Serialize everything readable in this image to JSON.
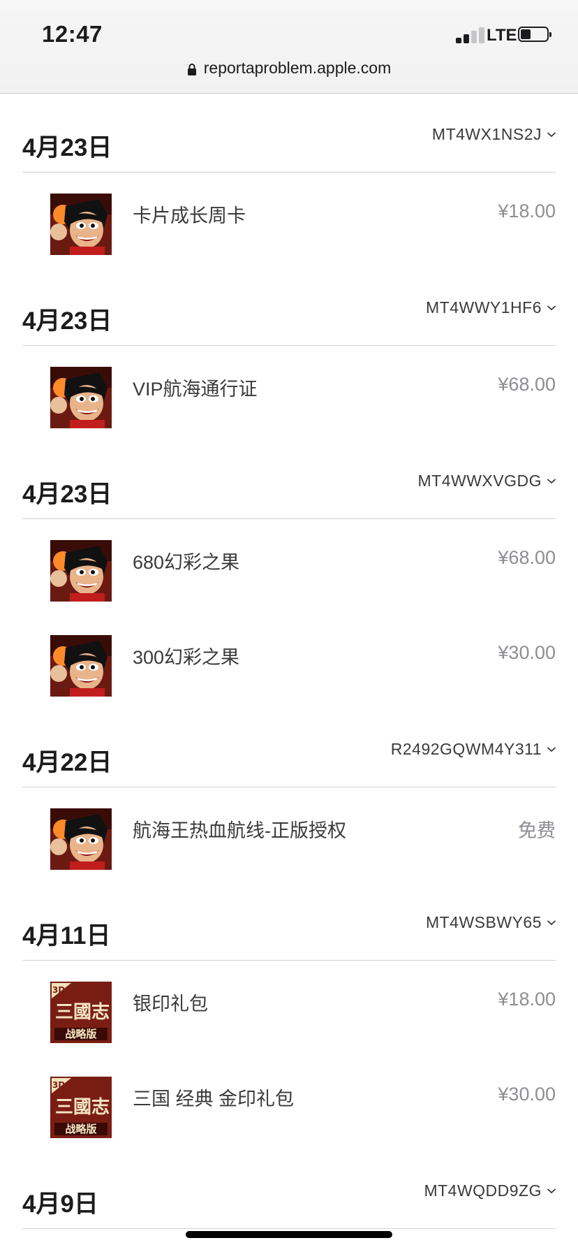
{
  "status_bar": {
    "time": "12:47",
    "network": "LTE"
  },
  "browser": {
    "url": "reportaproblem.apple.com"
  },
  "orders": [
    {
      "date": "4月23日",
      "order_id": "MT4WX1NS2J",
      "items": [
        {
          "icon": "luffy-game-icon",
          "name": "卡片成长周卡",
          "price": "¥18.00"
        }
      ]
    },
    {
      "date": "4月23日",
      "order_id": "MT4WWY1HF6",
      "items": [
        {
          "icon": "luffy-game-icon",
          "name": "VIP航海通行证",
          "price": "¥68.00"
        }
      ]
    },
    {
      "date": "4月23日",
      "order_id": "MT4WWXVGDG",
      "items": [
        {
          "icon": "luffy-game-icon",
          "name": "680幻彩之果",
          "price": "¥68.00"
        },
        {
          "icon": "luffy-game-icon",
          "name": "300幻彩之果",
          "price": "¥30.00"
        }
      ]
    },
    {
      "date": "4月22日",
      "order_id": "R2492GQWM4Y311",
      "items": [
        {
          "icon": "luffy-game-icon",
          "name": "航海王热血航线-正版授权",
          "price": "免费"
        }
      ]
    },
    {
      "date": "4月11日",
      "order_id": "MT4WSBWY65",
      "items": [
        {
          "icon": "sanguozhi-game-icon",
          "name": "银印礼包",
          "price": "¥18.00",
          "icon_text": {
            "badge": "3D",
            "title": "三國志",
            "subtitle": "战略版"
          }
        },
        {
          "icon": "sanguozhi-game-icon",
          "name": "三国 经典 金印礼包",
          "price": "¥30.00",
          "icon_text": {
            "badge": "3D",
            "title": "三國志",
            "subtitle": "战略版"
          }
        }
      ]
    },
    {
      "date": "4月9日",
      "order_id": "MT4WQDD9ZG",
      "items": []
    }
  ]
}
